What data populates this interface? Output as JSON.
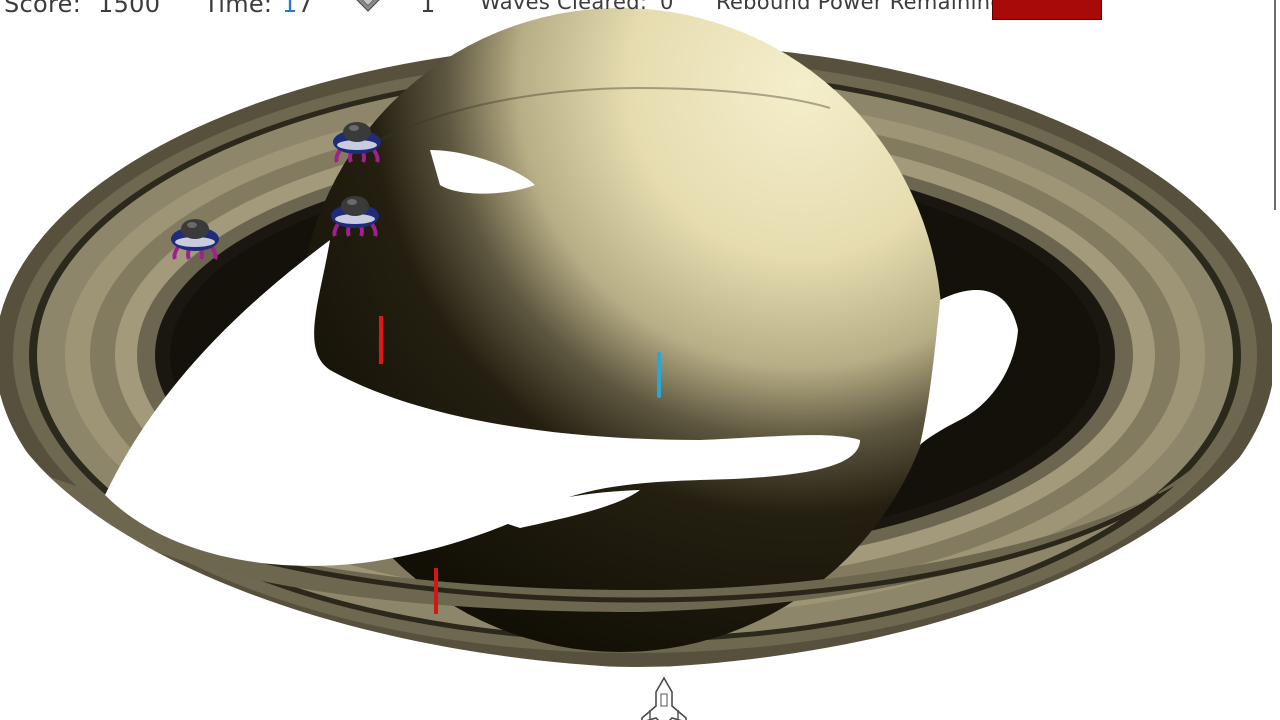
{
  "hud": {
    "score_label": "Score:",
    "score_value": "1500",
    "time_label": "Time:",
    "time_value": "17",
    "lives_icon": "heart-icon",
    "lives_value": "1",
    "waves_label": "Waves Cleared:",
    "waves_value": "0",
    "rebound_label": "Rebound Power Remaining:",
    "rebound_power_fraction": 1.0,
    "rebound_color": "#a80a0a"
  },
  "colors": {
    "ring_outer": "#5e5843",
    "ring_mid": "#8a8266",
    "ring_light": "#b5ab8c",
    "planet_light": "#eee7c3",
    "planet_dark": "#1a1608",
    "enemy_body": "#1e2c7a",
    "enemy_legs": "#a0208e",
    "enemy_dome": "#3a3a3a",
    "player_laser": "#28a8d8",
    "enemy_laser": "#e01818"
  },
  "entities": {
    "enemies": [
      {
        "name": "alien-saucer-1"
      },
      {
        "name": "alien-saucer-2"
      },
      {
        "name": "alien-saucer-3"
      }
    ],
    "enemy_lasers": 2,
    "player_lasers": 1,
    "player": "player-ship"
  }
}
